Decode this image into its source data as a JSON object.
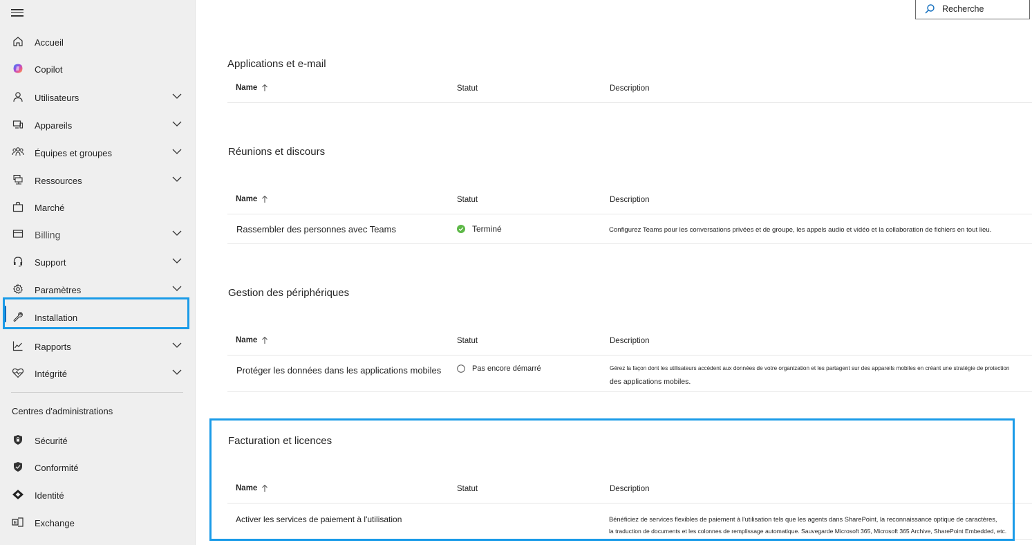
{
  "search": {
    "placeholder": "Recherche"
  },
  "sidebar": {
    "items": [
      {
        "label": "Accueil"
      },
      {
        "label": "Copilot"
      },
      {
        "label": "Utilisateurs"
      },
      {
        "label": "Appareils"
      },
      {
        "label": "Équipes et groupes"
      },
      {
        "label": "Ressources"
      },
      {
        "label": "Marché"
      },
      {
        "label": "Billing"
      },
      {
        "label": "Support"
      },
      {
        "label": "Paramètres"
      },
      {
        "label": "Installation"
      },
      {
        "label": "Rapports"
      },
      {
        "label": "Intégrité"
      }
    ],
    "admin_centers_label": "Centres d'administrations",
    "admin_centers": [
      {
        "label": "Sécurité"
      },
      {
        "label": "Conformité"
      },
      {
        "label": "Identité"
      },
      {
        "label": "Exchange"
      }
    ]
  },
  "columns": {
    "name": "Name",
    "status": "Statut",
    "description": "Description"
  },
  "sections": [
    {
      "title": "Applications et e-mail",
      "rows": []
    },
    {
      "title": "Réunions et discours",
      "rows": [
        {
          "name": "Rassembler des personnes avec Teams",
          "status": "Terminé",
          "description": "Configurez Teams pour les conversations privées et de groupe, les appels audio et vidéo et la collaboration de fichiers en tout lieu."
        }
      ]
    },
    {
      "title": "Gestion des périphériques",
      "rows": [
        {
          "name": "Protéger les données dans les applications mobiles",
          "status": "Pas encore démarré",
          "description_line1": "Gérez la façon dont les utilisateurs accèdent aux données de votre organization et les partagent sur des appareils mobiles en créant une stratégie de protection",
          "description_line2": "des applications mobiles."
        }
      ]
    },
    {
      "title": "Facturation et licences",
      "rows": [
        {
          "name": "Activer les services de paiement à l'utilisation",
          "status": "",
          "description_line1": "Bénéficiez de services flexibles de paiement à l'utilisation tels que les agents dans SharePoint, la reconnaissance optique de caractères,",
          "description_line2": "la traduction de documents et les colonnes de remplissage automatique. Sauvegarde Microsoft 365, Microsoft 365 Archive, SharePoint Embedded, etc."
        }
      ]
    }
  ],
  "colors": {
    "accent": "#0f6cbd",
    "highlight": "#1a9be8",
    "success": "#5db847",
    "sidebar_bg": "#efefef"
  }
}
